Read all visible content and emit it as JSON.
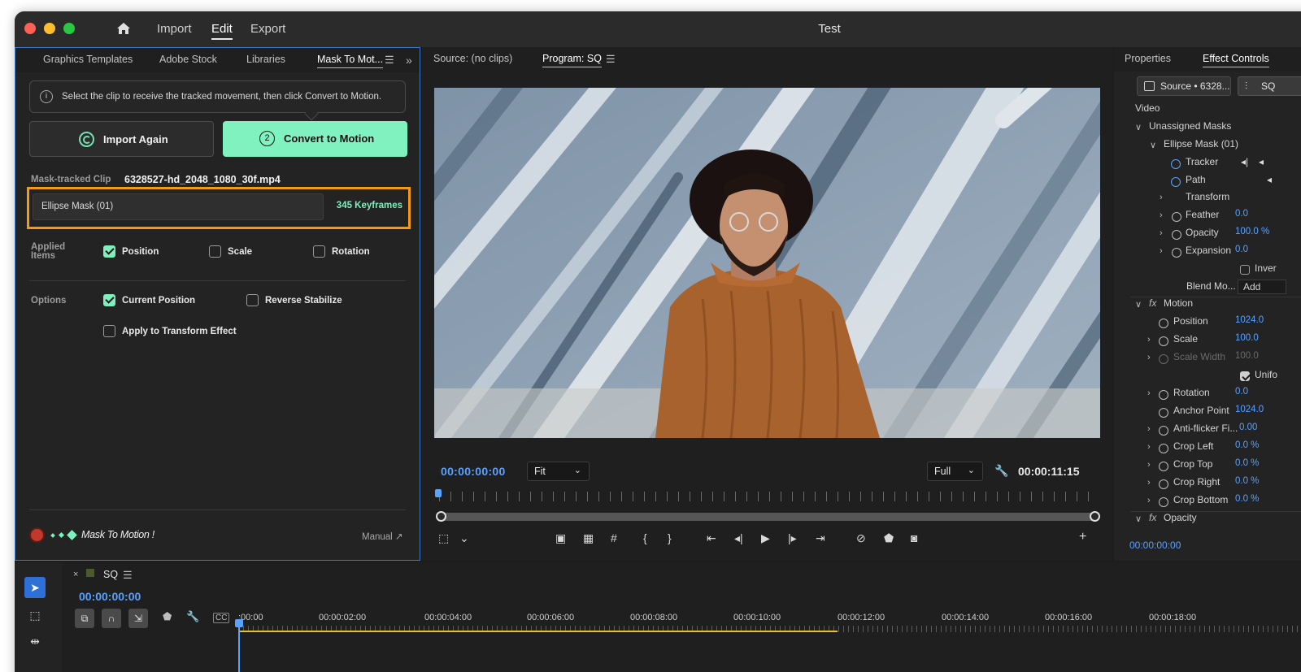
{
  "titlebar": {
    "workspaces": [
      "Import",
      "Edit",
      "Export"
    ],
    "active_workspace": "Edit",
    "document_title": "Test"
  },
  "left_panel": {
    "tabs": [
      "Graphics Templates",
      "Adobe Stock",
      "Libraries",
      "Mask To Mot..."
    ],
    "active_tab": "Mask To Mot...",
    "info_text": "Select the clip to receive the tracked movement, then click Convert to Motion.",
    "import_again_label": "Import Again",
    "convert_step": "2",
    "convert_label": "Convert to Motion",
    "mask_clip_label": "Mask-tracked Clip",
    "mask_clip_value": "6328527-hd_2048_1080_30f.mp4",
    "mask_name": "Ellipse Mask (01)",
    "keyframes": "345 Keyframes",
    "applied_items_label": "Applied Items",
    "applied_items": [
      {
        "label": "Position",
        "checked": true
      },
      {
        "label": "Scale",
        "checked": false
      },
      {
        "label": "Rotation",
        "checked": false
      }
    ],
    "options_label": "Options",
    "options": [
      {
        "label": "Current Position",
        "checked": true
      },
      {
        "label": "Reverse Stabilize",
        "checked": false
      },
      {
        "label": "Apply to Transform Effect",
        "checked": false
      }
    ],
    "logo_text": "Mask To Motion !",
    "manual_label": "Manual ↗"
  },
  "program_monitor": {
    "source_tab": "Source: (no clips)",
    "program_tab": "Program: SQ",
    "current_timecode": "00:00:00:00",
    "fit_label": "Fit",
    "quality_label": "Full",
    "duration_timecode": "00:00:11:15"
  },
  "effect_controls": {
    "tabs": [
      "Properties",
      "Effect Controls"
    ],
    "active_tab": "Effect Controls",
    "source_chip": "Source • 6328...",
    "sequence_chip": "SQ",
    "section_video": "Video",
    "rows": {
      "unassigned": "Unassigned Masks",
      "ellipse": "Ellipse Mask (01)",
      "tracker": "Tracker",
      "path": "Path",
      "transform": "Transform",
      "feather": "Feather",
      "feather_val": "0.0",
      "opacity": "Opacity",
      "opacity_val": "100.0 %",
      "expansion": "Expansion",
      "expansion_val": "0.0",
      "inverted": "Inver",
      "blend": "Blend Mo...",
      "blend_val": "Add",
      "motion": "Motion",
      "position": "Position",
      "position_val": "1024.0",
      "scale": "Scale",
      "scale_val": "100.0",
      "scale_width": "Scale Width",
      "scale_width_val": "100.0",
      "uniform": "Unifo",
      "rotation": "Rotation",
      "rotation_val": "0.0",
      "anchor": "Anchor Point",
      "anchor_val": "1024.0",
      "antiflicker": "Anti-flicker Fi...",
      "antiflicker_val": "0.00",
      "crop_left": "Crop Left",
      "crop_left_val": "0.0 %",
      "crop_top": "Crop Top",
      "crop_top_val": "0.0 %",
      "crop_right": "Crop Right",
      "crop_right_val": "0.0 %",
      "crop_bottom": "Crop Bottom",
      "crop_bottom_val": "0.0 %",
      "opacity_fx": "Opacity"
    },
    "timecode": "00:00:00:00"
  },
  "timeline": {
    "sequence_name": "SQ",
    "timecode": "00:00:00:00",
    "ticks": [
      ":00:00",
      "00:00:02:00",
      "00:00:04:00",
      "00:00:06:00",
      "00:00:08:00",
      "00:00:10:00",
      "00:00:12:00",
      "00:00:14:00",
      "00:00:16:00",
      "00:00:18:00"
    ]
  }
}
